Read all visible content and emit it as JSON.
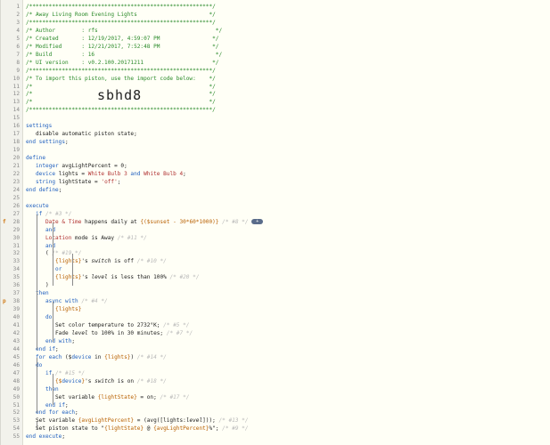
{
  "editor": {
    "import_code": "sbhd8",
    "lines": [
      {
        "n": "1",
        "t": "/********************************************************/"
      },
      {
        "n": "2",
        "t": "/* Away Living Room Evening Lights                      */"
      },
      {
        "n": "3",
        "t": "/********************************************************/"
      },
      {
        "n": "4",
        "t": "/* Author        : rfs                                    */"
      },
      {
        "n": "5",
        "t": "/* Created       : 12/19/2017, 4:59:07 PM                */"
      },
      {
        "n": "6",
        "t": "/* Modified      : 12/21/2017, 7:52:48 PM                */"
      },
      {
        "n": "7",
        "t": "/* Build         : 16                                     */"
      },
      {
        "n": "8",
        "t": "/* UI version    : v0.2.100.20171211                     */"
      },
      {
        "n": "9",
        "t": "/********************************************************/"
      },
      {
        "n": "10",
        "t": "/* To import this piston, use the import code below:    */"
      },
      {
        "n": "11",
        "t": "/*                                                      */"
      },
      {
        "n": "12",
        "t": "/*                                                      */"
      },
      {
        "n": "13",
        "t": "/*                                                      */"
      },
      {
        "n": "14",
        "t": "/********************************************************/"
      },
      {
        "n": "15",
        "t": ""
      },
      {
        "n": "16",
        "t": "settings"
      },
      {
        "n": "17",
        "t": "   disable automatic piston state;"
      },
      {
        "n": "18",
        "t": "end settings;"
      },
      {
        "n": "19",
        "t": ""
      },
      {
        "n": "20",
        "t": "define"
      },
      {
        "n": "21",
        "t": "   integer avgLightPercent = 0;"
      },
      {
        "n": "22",
        "t": "   device lights = White Bulb 3 and White Bulb 4;"
      },
      {
        "n": "23",
        "t": "   string lightState = 'off';"
      },
      {
        "n": "24",
        "t": "end define;"
      },
      {
        "n": "25",
        "t": ""
      },
      {
        "n": "26",
        "t": "execute"
      },
      {
        "n": "27",
        "t": "   if /* #3 */"
      },
      {
        "n": "28",
        "t": "      Date & Time happens daily at {($sunset - 30*60*1000)} /* #8 */"
      },
      {
        "n": "29",
        "t": "      and"
      },
      {
        "n": "30",
        "t": "      Location mode is Away /* #11 */"
      },
      {
        "n": "31",
        "t": "      and"
      },
      {
        "n": "32",
        "t": "      ( /* #19 */"
      },
      {
        "n": "33",
        "t": "         {lights}'s switch is off /* #10 */"
      },
      {
        "n": "34",
        "t": "         or"
      },
      {
        "n": "35",
        "t": "         {lights}'s level is less than 100% /* #20 */"
      },
      {
        "n": "36",
        "t": "      )"
      },
      {
        "n": "37",
        "t": "   then"
      },
      {
        "n": "38",
        "t": "      async with /* #4 */"
      },
      {
        "n": "39",
        "t": "         {lights}"
      },
      {
        "n": "40",
        "t": "      do"
      },
      {
        "n": "41",
        "t": "         Set color temperature to 2732°K; /* #5 */"
      },
      {
        "n": "42",
        "t": "         Fade level to 100% in 30 minutes; /* #7 */"
      },
      {
        "n": "43",
        "t": "      end with;"
      },
      {
        "n": "44",
        "t": "   end if;"
      },
      {
        "n": "45",
        "t": "   for each ($device in {lights}) /* #14 */"
      },
      {
        "n": "46",
        "t": "   do"
      },
      {
        "n": "47",
        "t": "      if /* #15 */"
      },
      {
        "n": "48",
        "t": "         {$device}'s switch is on /* #18 */"
      },
      {
        "n": "49",
        "t": "      then"
      },
      {
        "n": "50",
        "t": "         Set variable {lightState} = on; /* #17 */"
      },
      {
        "n": "51",
        "t": "      end if;"
      },
      {
        "n": "52",
        "t": "   end for each;"
      },
      {
        "n": "53",
        "t": "   Set variable {avgLightPercent} = (avg([lights:level])); /* #13 */"
      },
      {
        "n": "54",
        "t": "   Set piston state to \"{lightState} @ {avgLightPercent}%\"; /* #9 */"
      },
      {
        "n": "55",
        "t": "end execute;"
      }
    ],
    "flags": {
      "28": "f",
      "38": "p"
    },
    "pill_label": "+"
  }
}
